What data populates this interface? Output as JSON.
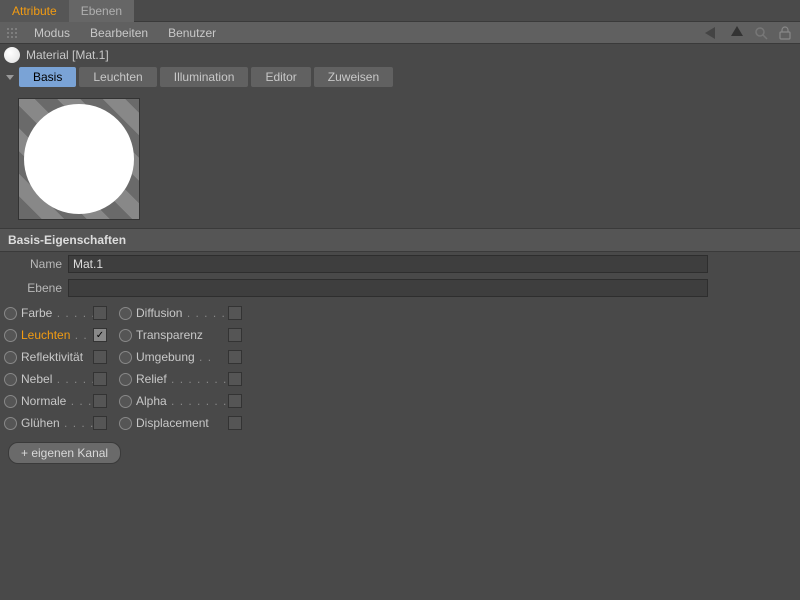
{
  "topTabs": {
    "active": "Attribute",
    "other": "Ebenen"
  },
  "menu": {
    "modus": "Modus",
    "bearbeiten": "Bearbeiten",
    "benutzer": "Benutzer"
  },
  "material": {
    "title": "Material [Mat.1]"
  },
  "channelTabs": {
    "basis": "Basis",
    "leuchten": "Leuchten",
    "illumination": "Illumination",
    "editor": "Editor",
    "zuweisen": "Zuweisen"
  },
  "section": {
    "title": "Basis-Eigenschaften"
  },
  "fields": {
    "nameLabel": "Name",
    "nameValue": "Mat.1",
    "ebeneLabel": "Ebene",
    "ebeneValue": ""
  },
  "channels": {
    "left": [
      {
        "label": "Farbe",
        "checked": false,
        "active": false
      },
      {
        "label": "Leuchten",
        "checked": true,
        "active": true
      },
      {
        "label": "Reflektivität",
        "checked": false,
        "active": false
      },
      {
        "label": "Nebel",
        "checked": false,
        "active": false
      },
      {
        "label": "Normale",
        "checked": false,
        "active": false
      },
      {
        "label": "Glühen",
        "checked": false,
        "active": false
      }
    ],
    "right": [
      {
        "label": "Diffusion",
        "checked": false,
        "active": false
      },
      {
        "label": "Transparenz",
        "checked": false,
        "active": false
      },
      {
        "label": "Umgebung",
        "checked": false,
        "active": false
      },
      {
        "label": "Relief",
        "checked": false,
        "active": false
      },
      {
        "label": "Alpha",
        "checked": false,
        "active": false
      },
      {
        "label": "Displacement",
        "checked": false,
        "active": false
      }
    ]
  },
  "buttons": {
    "addChannel": "+ eigenen Kanal"
  }
}
